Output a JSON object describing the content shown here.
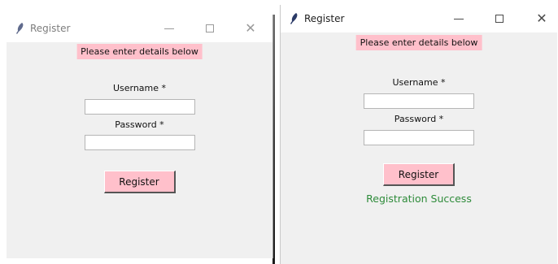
{
  "windows": [
    {
      "title": "Register",
      "banner": "Please enter details below",
      "username_label": "Username *",
      "username_value": "",
      "password_label": "Password *",
      "password_value": "",
      "register_label": "Register",
      "status_text": ""
    },
    {
      "title": "Register",
      "banner": "Please enter details below",
      "username_label": "Username *",
      "username_value": "",
      "password_label": "Password *",
      "password_value": "",
      "register_label": "Register",
      "status_text": "Registration Success"
    }
  ],
  "colors": {
    "banner_bg": "#ffc0cb",
    "button_bg": "#ffc0cb",
    "window_bg": "#f0f0f0",
    "success_text": "#2e8b3a"
  },
  "icons": {
    "app": "feather-icon",
    "minimize": "minimize-icon",
    "maximize": "maximize-icon",
    "close": "close-icon"
  }
}
